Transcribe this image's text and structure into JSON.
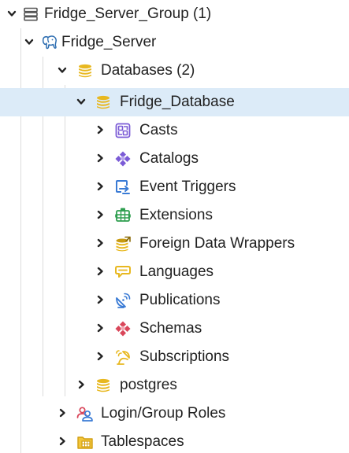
{
  "tree": {
    "server_group": {
      "label": "Fridge_Server_Group (1)",
      "icon": "server-group-icon",
      "state": "expanded"
    },
    "server": {
      "label": "Fridge_Server",
      "icon": "postgres-elephant-icon",
      "state": "expanded"
    },
    "databases": {
      "label": "Databases (2)",
      "icon": "database-icon",
      "state": "expanded"
    },
    "fridge_database": {
      "label": "Fridge_Database",
      "icon": "database-icon",
      "state": "expanded",
      "selected": true
    },
    "children": [
      {
        "label": "Casts",
        "icon": "casts-icon"
      },
      {
        "label": "Catalogs",
        "icon": "catalogs-icon"
      },
      {
        "label": "Event Triggers",
        "icon": "event-triggers-icon"
      },
      {
        "label": "Extensions",
        "icon": "extensions-icon"
      },
      {
        "label": "Foreign Data Wrappers",
        "icon": "foreign-data-wrappers-icon"
      },
      {
        "label": "Languages",
        "icon": "languages-icon"
      },
      {
        "label": "Publications",
        "icon": "publications-icon"
      },
      {
        "label": "Schemas",
        "icon": "schemas-icon"
      },
      {
        "label": "Subscriptions",
        "icon": "subscriptions-icon"
      }
    ],
    "postgres": {
      "label": "postgres",
      "icon": "database-icon",
      "state": "collapsed"
    },
    "login_roles": {
      "label": "Login/Group Roles",
      "icon": "login-group-roles-icon",
      "state": "collapsed"
    },
    "tablespaces": {
      "label": "Tablespaces",
      "icon": "tablespaces-icon",
      "state": "collapsed"
    }
  },
  "colors": {
    "selected_row": "#dcebf8",
    "guide_line": "#dcdcdc",
    "database_gold": "#e8b820",
    "purple": "#7b5bd6",
    "blue": "#3a7bd5",
    "green": "#2e9e4f",
    "red": "#d9465a"
  }
}
